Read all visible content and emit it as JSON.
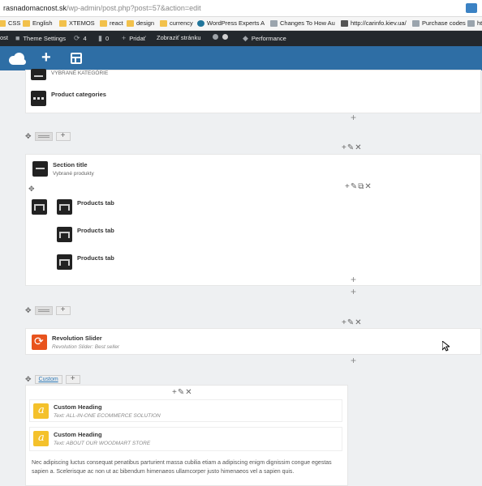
{
  "browser": {
    "url_host": "rasnadomacnost.sk",
    "url_path": "/wp-admin/post.php?post=57&action=edit",
    "bookmarks": [
      "CSS",
      "English",
      "XTEMOS",
      "react",
      "design",
      "currency",
      "WordPress Experts A",
      "Changes To How Au",
      "http://carinfo.kiev.ua/",
      "Purchase codes",
      "htt"
    ]
  },
  "adminbar": {
    "site_prefix": "ost",
    "theme_settings": "Theme Settings",
    "updates_count": "4",
    "comments_count": "0",
    "add_new": "Pridať",
    "view_page": "Zobraziť stránku",
    "performance": "Performance"
  },
  "builder": {
    "rows": {
      "r1_cut_text": "VYBRANÉ KATEGÓRIE",
      "r1_element": "Product categories",
      "r2_title": "Section title",
      "r2_subtitle": "Vybrané produkty",
      "r2_tabs": [
        "Products tab",
        "Products tab",
        "Products tab"
      ],
      "r3_title": "Revolution Slider",
      "r3_subtitle": "Revolution Slider: Best seller",
      "r4_label": "Custom",
      "r4_heading1": "Custom Heading",
      "r4_heading1_sub": "Text: ALL-IN-ONE ECOMMERCE SOLUTION",
      "r4_heading2": "Custom Heading",
      "r4_heading2_sub": "Text: ABOUT OUR WOODMART STORE",
      "r4_paragraph": "Nec adipiscing luctus consequat penatibus parturient massa cubilia etiam a adipiscing enigm dignissim congue egestas sapien a. Scelerisque ac non ut ac bibendum himenaeos ullamcorper justo himenaeos vel a sapien quis."
    },
    "icons": [
      "logo-icon",
      "add-icon",
      "layout-icon",
      "move-icon",
      "plus-icon",
      "pencil-icon",
      "close-icon",
      "copy-icon"
    ],
    "colors": {
      "toolbar": "#2e6ea5",
      "adminbar": "#23282d",
      "revolution": "#e8531d",
      "heading": "#f4c12b"
    }
  }
}
